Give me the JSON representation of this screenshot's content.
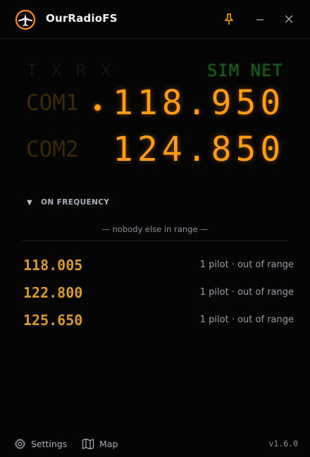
{
  "app": {
    "title": "OurRadioFS",
    "logo_icon": "plane-in-ring-icon",
    "accent": "#ff9c1a"
  },
  "titlebar": {
    "pin_icon": "pin-icon",
    "minimize_icon": "minimize-icon",
    "close_icon": "close-icon"
  },
  "radio": {
    "indicators_left": "T X R X",
    "indicators_right": "SIM NET",
    "com1": {
      "label": "COM1",
      "frequency": "118.950",
      "active": true
    },
    "com2": {
      "label": "COM2",
      "frequency": "124.850"
    }
  },
  "on_frequency": {
    "header": "ON FREQUENCY",
    "empty_text": "— nobody else in range —",
    "channels": [
      {
        "frequency": "118.005",
        "status": "1 pilot · out of range"
      },
      {
        "frequency": "122.800",
        "status": "1 pilot · out of range"
      },
      {
        "frequency": "125.650",
        "status": "1 pilot · out of range"
      }
    ]
  },
  "footer": {
    "settings_label": "Settings",
    "map_label": "Map",
    "version": "v1.6.0"
  }
}
